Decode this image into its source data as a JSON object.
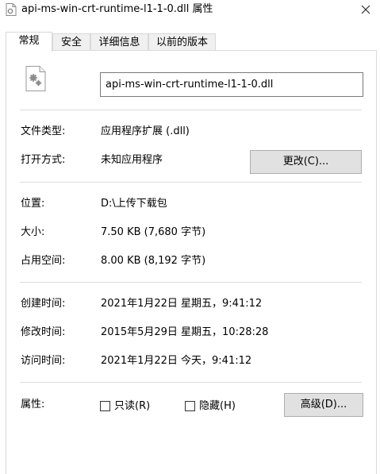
{
  "window": {
    "title": "api-ms-win-crt-runtime-l1-1-0.dll 属性",
    "close_glyph": "✕"
  },
  "tabs": [
    {
      "label": "常规",
      "active": true
    },
    {
      "label": "安全",
      "active": false
    },
    {
      "label": "详细信息",
      "active": false
    },
    {
      "label": "以前的版本",
      "active": false
    }
  ],
  "general": {
    "filename": "api-ms-win-crt-runtime-l1-1-0.dll",
    "file_icon": "dll-file-gear-icon",
    "file_type_label": "文件类型:",
    "file_type_value": "应用程序扩展 (.dll)",
    "open_with_label": "打开方式:",
    "open_with_value": "未知应用程序",
    "change_button": "更改(C)...",
    "location_label": "位置:",
    "location_value": "D:\\上传下载包",
    "size_label": "大小:",
    "size_value": "7.50 KB (7,680 字节)",
    "size_on_disk_label": "占用空间:",
    "size_on_disk_value": "8.00 KB (8,192 字节)",
    "created_label": "创建时间:",
    "created_value": "2021年1月22日 星期五，9:41:12",
    "modified_label": "修改时间:",
    "modified_value": "2015年5月29日 星期五，10:28:28",
    "accessed_label": "访问时间:",
    "accessed_value": "2021年1月22日 今天，9:41:12",
    "attributes_label": "属性:",
    "readonly_label": "只读(R)",
    "readonly_checked": false,
    "hidden_label": "隐藏(H)",
    "hidden_checked": false,
    "advanced_button": "高级(D)..."
  },
  "colors": {
    "panel_border": "#d9d9d9",
    "button_bg": "#e1e1e1",
    "button_border": "#adadad",
    "separator": "#dcdcdc"
  }
}
